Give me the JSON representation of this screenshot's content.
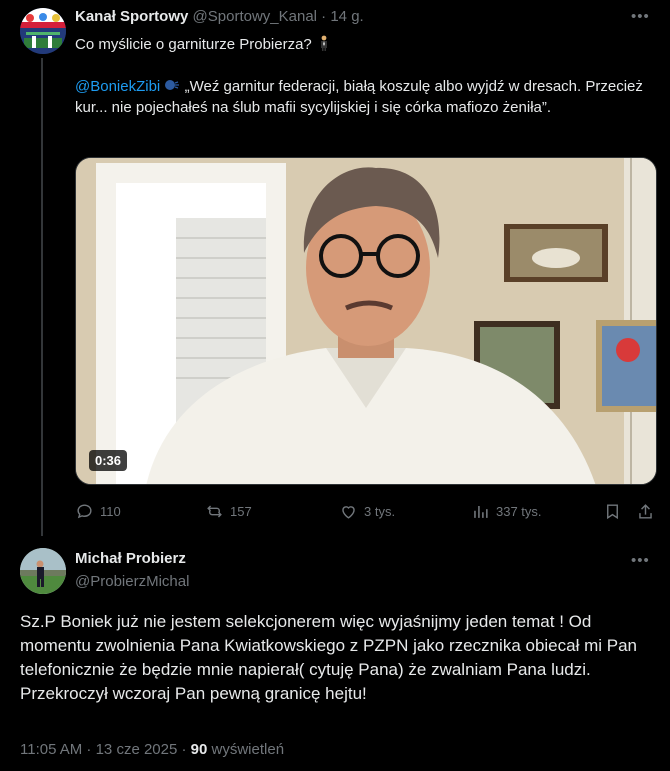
{
  "tweet1": {
    "name": "Kanał Sportowy",
    "handle": "@Sportowy_Kanal",
    "separator": "·",
    "time": "14 g.",
    "line1": "Co myślicie o garniturze Probierza? ",
    "mention": "@BoniekZibi",
    "quote": " „Weź garnitur federacji, białą koszulę albo wyjdź w dresach. Przecież kur... nie pojechałeś na ślub mafii sycylijskiej i się córka mafiozo żeniła”.",
    "video_duration": "0:36",
    "actions": {
      "replies": "110",
      "reposts": "157",
      "likes": "3 tys.",
      "views": "337 tys."
    },
    "more_icon": "more-icon"
  },
  "tweet2": {
    "name": "Michał Probierz",
    "handle": "@ProbierzMichal",
    "text": "Sz.P Boniek już nie jestem selekcjonerem więc wyjaśnijmy jeden temat ! Od momentu zwolnienia Pana Kwiatkowskiego z PZPN jako rzecznika obiecał mi Pan telefonicznie że będzie mnie napierał( cytuję Pana) że zwalniam Pana ludzi. Przekroczył wczoraj Pan pewną granicę hejtu!",
    "timestamp": "11:05 AM · 13 cze 2025 · ",
    "views_count": "90",
    "views_label": " wyświetleń"
  },
  "colors": {
    "background": "#000000",
    "text": "#e7e9ea",
    "secondary": "#71767b",
    "link": "#1d9bf0",
    "border": "#2f3336"
  }
}
